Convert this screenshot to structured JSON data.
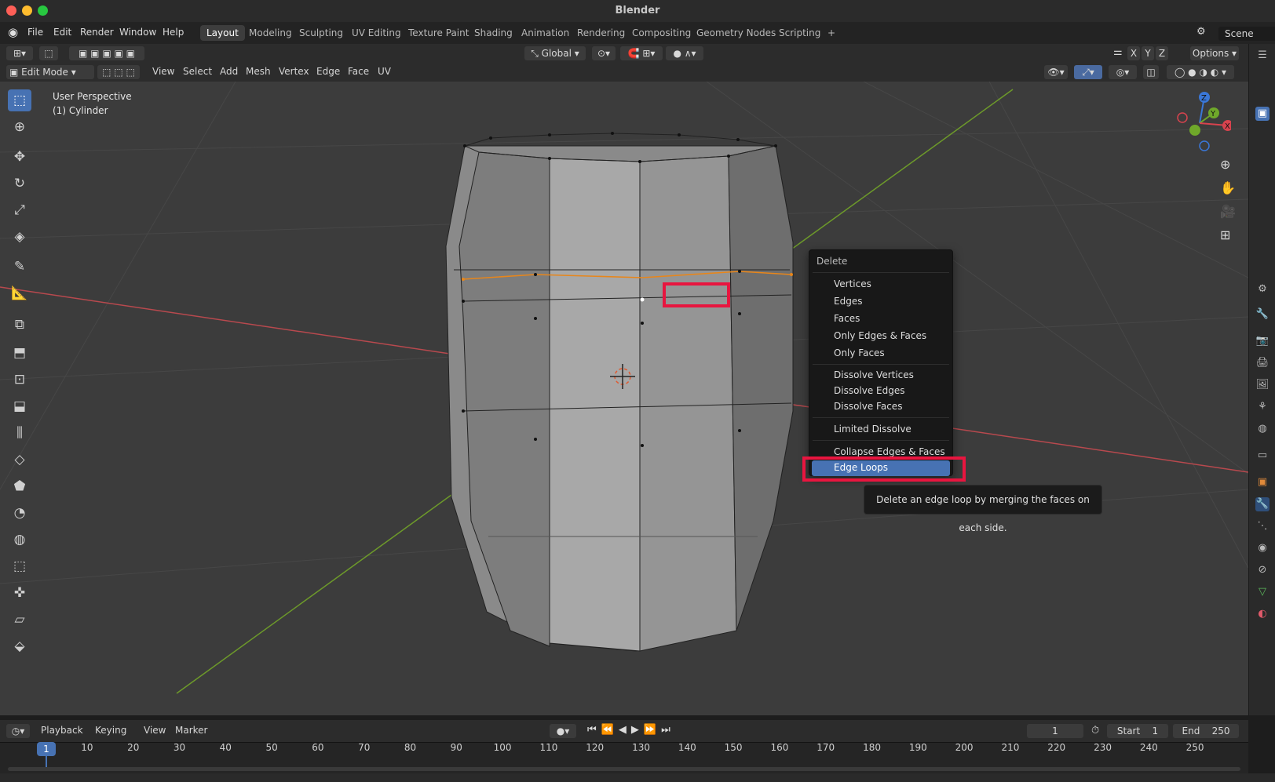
{
  "app": {
    "title": "Blender"
  },
  "menubar": {
    "items": [
      "File",
      "Edit",
      "Render",
      "Window",
      "Help"
    ],
    "workspaces": [
      "Layout",
      "Modeling",
      "Sculpting",
      "UV Editing",
      "Texture Paint",
      "Shading",
      "Animation",
      "Rendering",
      "Compositing",
      "Geometry Nodes",
      "Scripting"
    ],
    "active_workspace": "Layout",
    "add_tab": "+",
    "scene": "Scene"
  },
  "header1": {
    "transform_orientation": "Global",
    "axes": [
      "X",
      "Y",
      "Z"
    ],
    "options": "Options"
  },
  "header2": {
    "mode": "Edit Mode",
    "menus": [
      "View",
      "Select",
      "Add",
      "Mesh",
      "Vertex",
      "Edge",
      "Face",
      "UV"
    ]
  },
  "viewport": {
    "perspective": "User Perspective",
    "object": "(1) Cylinder",
    "gizmo": {
      "z": "Z",
      "y": "Y",
      "x": "X"
    }
  },
  "delete_menu": {
    "title": "Delete",
    "items": [
      "Vertices",
      "Edges",
      "Faces",
      "Only Edges & Faces",
      "Only Faces",
      "Dissolve Vertices",
      "Dissolve Edges",
      "Dissolve Faces",
      "Limited Dissolve",
      "Collapse Edges & Faces",
      "Edge Loops"
    ],
    "highlighted": "Edge Loops",
    "tooltip": "Delete an edge loop by merging the faces on each side."
  },
  "timeline": {
    "menus": [
      "Playback",
      "Keying",
      "View",
      "Marker"
    ],
    "current_frame": "1",
    "start_label": "Start",
    "start": "1",
    "end_label": "End",
    "end": "250",
    "ticks": [
      "10",
      "20",
      "30",
      "40",
      "50",
      "60",
      "70",
      "80",
      "90",
      "100",
      "110",
      "120",
      "130",
      "140",
      "150",
      "160",
      "170",
      "180",
      "190",
      "200",
      "210",
      "220",
      "230",
      "240",
      "250"
    ]
  },
  "colors": {
    "accent": "#4772b3",
    "highlight_box": "#e8153f",
    "selected_edge": "#e8861a",
    "x_axis": "#b8494e",
    "y_axis": "#6d9a2a"
  }
}
